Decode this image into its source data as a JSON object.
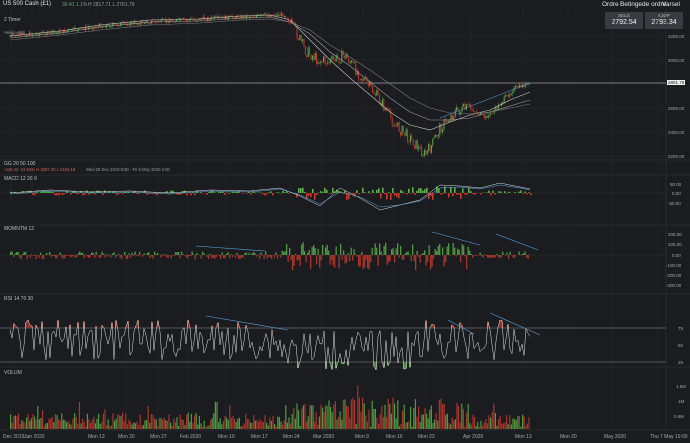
{
  "instrument": {
    "title": "US 500 Cash (£1)",
    "change": "30.41  1.1%",
    "ohlc": "H 2817.71  L 2761.79"
  },
  "menu": {
    "items": [
      "Ordre",
      "Betingede ordre",
      "Varsel"
    ]
  },
  "quote": {
    "sell_label": "SELG",
    "sell_value": "2792.54",
    "buy_label": "KJØP",
    "buy_value": "2793.34"
  },
  "main_pane": {
    "timeframe": "2 Timer",
    "sub": "Heikin-Ashi",
    "y_ticks": [
      "3200.00",
      "3000.00",
      "2800.00",
      "2600.00",
      "2400.00",
      "2200.00"
    ],
    "last_price_tag": "2801.75"
  },
  "gg_pane": {
    "label": "GG  20  50  100",
    "values": "-446.33   -12.94%     H 3397.20   L 2184.19",
    "date_range": "Wed 25 Dec 2019 8:00 - Fri 8 May 2020 2:00"
  },
  "macd": {
    "label": "MACD  12  26  9",
    "y_ticks": [
      "50.00",
      "0.00",
      "-50.00"
    ]
  },
  "momentum": {
    "label": "MOMNTM  12",
    "y_ticks": [
      "200.00",
      "100.00",
      "0.00",
      "-100.00",
      "-200.00",
      "-300.00"
    ]
  },
  "rsi": {
    "label": "RSI  14  70  30",
    "y_ticks": [
      "75",
      "50",
      "25"
    ]
  },
  "volume": {
    "label": "VOLUM",
    "y_ticks": [
      "1.5M",
      "1M",
      "0.5M"
    ]
  },
  "x_axis": [
    "Dec 2019",
    "Jan 2020",
    "Mon 13",
    "Mon 20",
    "Mon 27",
    "Feb 2020",
    "Mon 10",
    "Mon 17",
    "Mon 24",
    "Mar 2020",
    "Mon 9",
    "Mon 16",
    "Mon 23",
    "Apr 2020",
    "Mon 13",
    "Mon 20",
    "May 2020",
    "Thu 7 May 19:00"
  ],
  "colors": {
    "up": "#5fae4f",
    "down": "#c53b2e",
    "trend": "#5aa9e6",
    "background": "#1b1c20",
    "grid": "#2b2c31"
  }
}
